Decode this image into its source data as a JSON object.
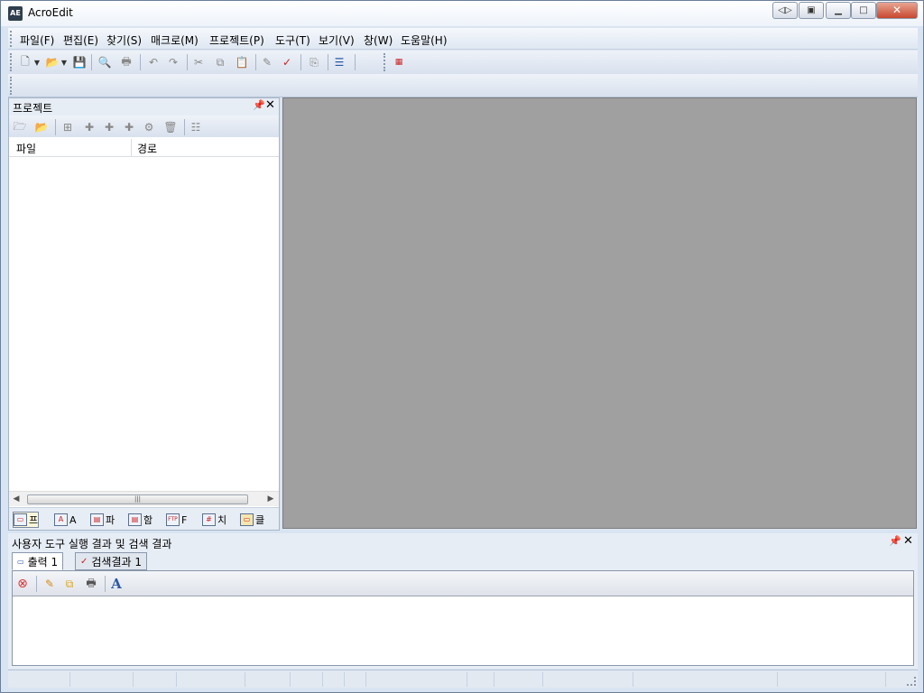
{
  "window": {
    "title": "AcroEdit",
    "app_icon_text": "AE"
  },
  "menu": [
    "파일(F)",
    "편집(E)",
    "찾기(S)",
    "매크로(M)",
    "프로젝트(P)",
    "도구(T)",
    "보기(V)",
    "창(W)",
    "도움말(H)"
  ],
  "project_panel": {
    "title": "프로젝트",
    "columns": [
      "파일",
      "경로"
    ],
    "tabs": [
      "프",
      "A",
      "파",
      "함",
      "F",
      "치",
      "클"
    ]
  },
  "output_panel": {
    "title": "사용자 도구 실행 결과 및 검색 결과",
    "tabs": [
      "출력 1",
      "검색결과 1"
    ]
  },
  "colors": {
    "editor_bg": "#a0a0a0",
    "chrome": "#d9e4f2"
  }
}
